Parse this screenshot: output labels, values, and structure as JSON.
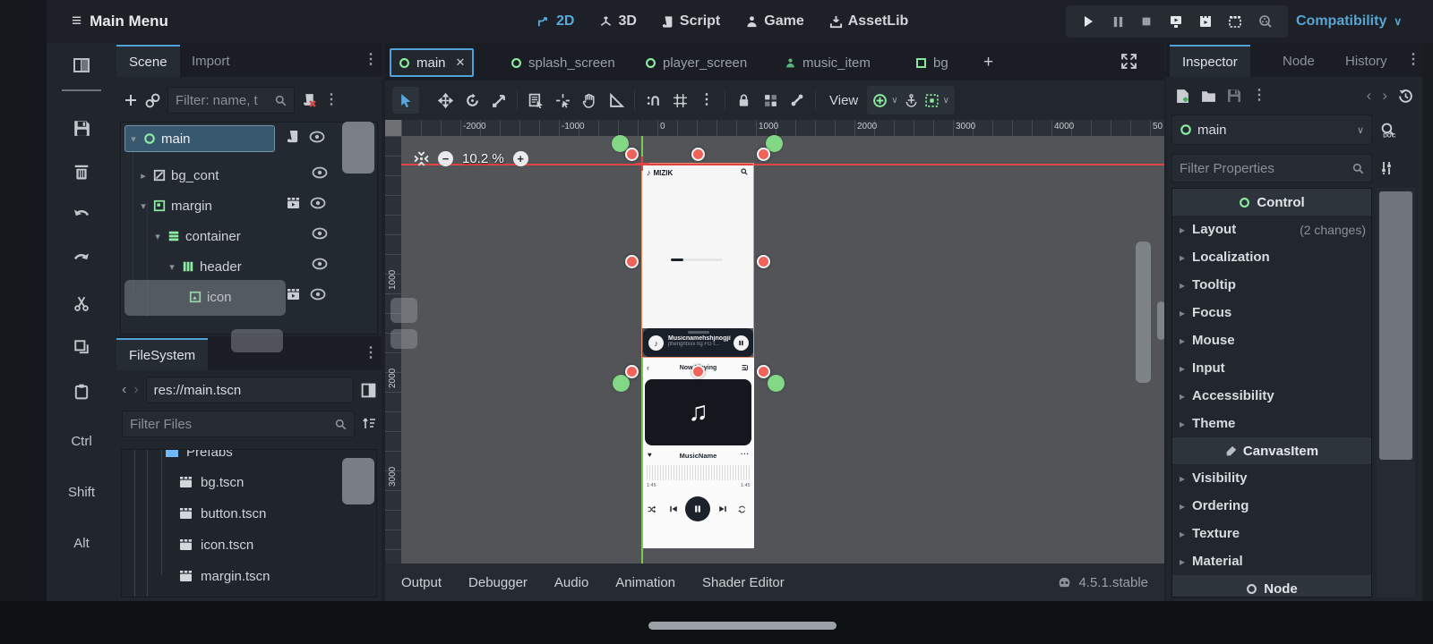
{
  "topbar": {
    "menu": "Main Menu",
    "workspaces": [
      "2D",
      "3D",
      "Script",
      "Game",
      "AssetLib"
    ],
    "renderer": "Compatibility"
  },
  "left_rail": {
    "modifiers": [
      "Ctrl",
      "Shift",
      "Alt"
    ]
  },
  "scene_dock": {
    "tabs": [
      "Scene",
      "Import"
    ],
    "filter_placeholder": "Filter: name, t",
    "nodes": [
      "main",
      "bg_cont",
      "margin",
      "container",
      "header",
      "icon"
    ]
  },
  "filesystem": {
    "title": "FileSystem",
    "path": "res://main.tscn",
    "filter_placeholder": "Filter Files",
    "folder": "Prefabs",
    "files": [
      "bg.tscn",
      "button.tscn",
      "icon.tscn",
      "margin.tscn"
    ]
  },
  "viewport": {
    "tabs": [
      "main",
      "splash_screen",
      "player_screen",
      "music_item",
      "bg"
    ],
    "add_tab": "+",
    "close_tab": "✕",
    "view_label": "View",
    "zoom": "10.2 %",
    "ruler_h": [
      "-2000",
      "-1000",
      "0",
      "1000",
      "2000",
      "3000",
      "4000",
      "50"
    ],
    "ruler_v": [
      "1000",
      "2000",
      "3000"
    ]
  },
  "mockup": {
    "brand": "MIZIK",
    "mini": {
      "title": "Musicnamehshjnogjil",
      "subtitle": "jtherightxxx hg FG t..."
    },
    "player": {
      "title": "Now Playing",
      "song": "MusicName",
      "time_a": "1:45",
      "time_b": "1:45"
    }
  },
  "inspector": {
    "tabs": [
      "Inspector",
      "Node",
      "History"
    ],
    "node": "main",
    "filter_placeholder": "Filter Properties",
    "sections": [
      {
        "kind": "category",
        "label": "Control"
      },
      {
        "kind": "group",
        "label": "Layout",
        "badge": "(2 changes)"
      },
      {
        "kind": "group",
        "label": "Localization"
      },
      {
        "kind": "group",
        "label": "Tooltip"
      },
      {
        "kind": "group",
        "label": "Focus"
      },
      {
        "kind": "group",
        "label": "Mouse"
      },
      {
        "kind": "group",
        "label": "Input"
      },
      {
        "kind": "group",
        "label": "Accessibility"
      },
      {
        "kind": "group",
        "label": "Theme"
      },
      {
        "kind": "category",
        "label": "CanvasItem"
      },
      {
        "kind": "group",
        "label": "Visibility"
      },
      {
        "kind": "group",
        "label": "Ordering"
      },
      {
        "kind": "group",
        "label": "Texture"
      },
      {
        "kind": "group",
        "label": "Material"
      },
      {
        "kind": "category",
        "label": "Node"
      }
    ]
  },
  "bottom": {
    "tabs": [
      "Output",
      "Debugger",
      "Audio",
      "Animation",
      "Shader Editor"
    ],
    "version": "4.5.1.stable"
  }
}
